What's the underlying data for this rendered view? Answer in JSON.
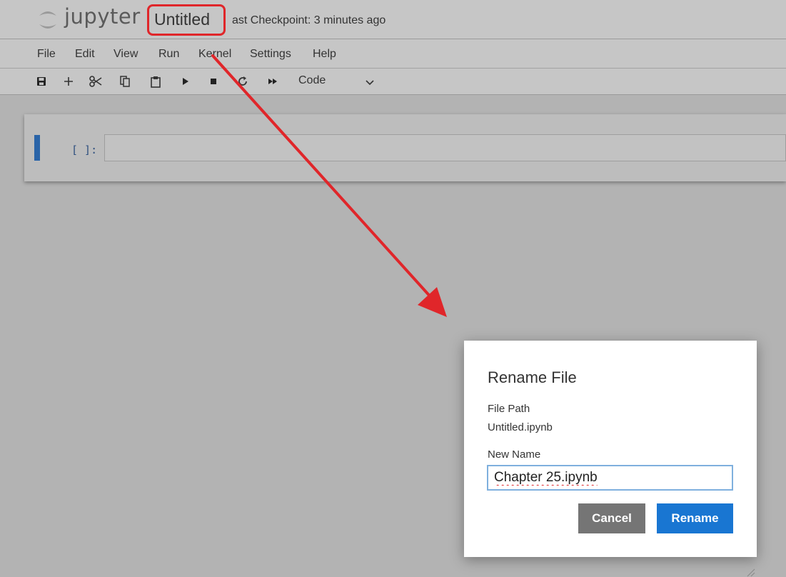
{
  "header": {
    "logo_text": "jupyter",
    "notebook_title": "Untitled",
    "checkpoint": "ast Checkpoint: 3 minutes ago",
    "accent_color": "#e0262a",
    "logo_color": "#f37726"
  },
  "menubar": {
    "items": [
      {
        "label": "File"
      },
      {
        "label": "Edit"
      },
      {
        "label": "View"
      },
      {
        "label": "Run"
      },
      {
        "label": "Kernel"
      },
      {
        "label": "Settings"
      },
      {
        "label": "Help"
      }
    ]
  },
  "toolbar": {
    "buttons": [
      "save-icon",
      "add-icon",
      "cut-icon",
      "copy-icon",
      "paste-icon",
      "run-icon",
      "stop-icon",
      "restart-icon",
      "fast-forward-icon"
    ],
    "cell_type": "Code"
  },
  "cell": {
    "prompt": "[ ]:",
    "marker_color": "#2a64a8"
  },
  "dialog": {
    "title": "Rename File",
    "file_path_label": "File Path",
    "file_path_value": "Untitled.ipynb",
    "new_name_label": "New Name",
    "new_name_value": "Chapter 25.ipynb",
    "cancel_label": "Cancel",
    "rename_label": "Rename",
    "rename_color": "#1976d2",
    "cancel_color": "#757575"
  }
}
